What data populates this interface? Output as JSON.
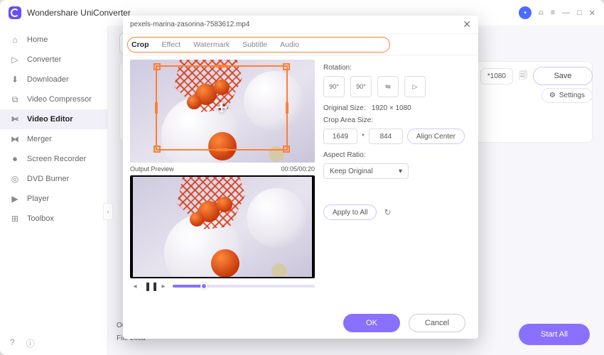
{
  "app": {
    "title": "Wondershare UniConverter"
  },
  "window": {
    "minimize": "—",
    "maximize": "□",
    "close": "✕"
  },
  "sidebar": {
    "items": [
      {
        "label": "Home",
        "icon": "⌂"
      },
      {
        "label": "Converter",
        "icon": "▷"
      },
      {
        "label": "Downloader",
        "icon": "⬇"
      },
      {
        "label": "Video Compressor",
        "icon": "⧉"
      },
      {
        "label": "Video Editor",
        "icon": "✄"
      },
      {
        "label": "Merger",
        "icon": "⧓"
      },
      {
        "label": "Screen Recorder",
        "icon": "⏺"
      },
      {
        "label": "DVD Burner",
        "icon": "◎"
      },
      {
        "label": "Player",
        "icon": "▶"
      },
      {
        "label": "Toolbox",
        "icon": "⊞"
      }
    ],
    "activeIndex": 4
  },
  "main": {
    "dims_label": "*1080",
    "save_label": "Save",
    "settings_label": "Settings",
    "output_label": "Output F",
    "fileloc_label": "File Loca",
    "startall_label": "Start All"
  },
  "modal": {
    "filename": "pexels-marina-zasorina-7583612.mp4",
    "tabs": [
      "Crop",
      "Effect",
      "Watermark",
      "Subtitle",
      "Audio"
    ],
    "activeTab": 0,
    "preview_label": "Output Preview",
    "timecode": "00:05/00:20",
    "rotation_label": "Rotation:",
    "rot_buttons": [
      "90°",
      "90°",
      "⇋",
      "▷"
    ],
    "original_size_label": "Original Size:",
    "original_size_value": "1920 × 1080",
    "crop_area_label": "Crop Area Size:",
    "crop_w": "1649",
    "crop_h": "844",
    "crop_sep": "*",
    "align_center_label": "Align Center",
    "aspect_label": "Aspect Ratio:",
    "aspect_value": "Keep Original",
    "apply_label": "Apply to All",
    "ok_label": "OK",
    "cancel_label": "Cancel"
  }
}
